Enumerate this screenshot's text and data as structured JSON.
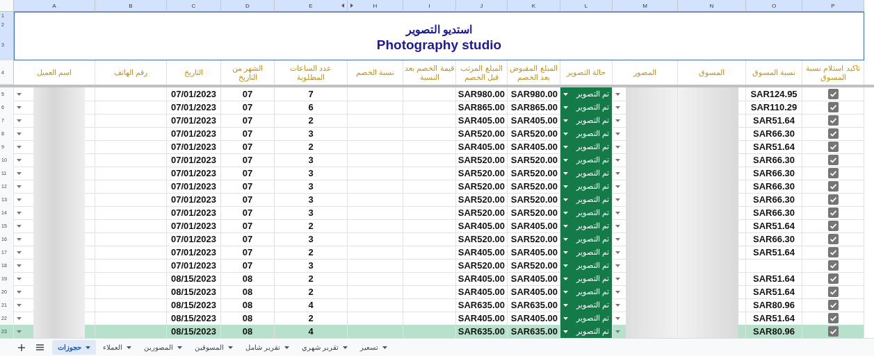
{
  "columns": [
    {
      "label": "P"
    },
    {
      "label": "O"
    },
    {
      "label": "N"
    },
    {
      "label": "M"
    },
    {
      "label": "L"
    },
    {
      "label": "K"
    },
    {
      "label": "J"
    },
    {
      "label": "I"
    },
    {
      "label": "H",
      "hidden_before": true
    },
    {
      "label": "E",
      "hidden_after": true
    },
    {
      "label": "D"
    },
    {
      "label": "C"
    },
    {
      "label": "B"
    },
    {
      "label": "A"
    }
  ],
  "title": {
    "row_numbers": [
      "1",
      "2",
      "3"
    ],
    "arabic": "استديو التصوير",
    "english": "Photography studio"
  },
  "header_row": {
    "number": "4",
    "cells": [
      "تاكيد استلام نسبة المسوق",
      "نسبة المسوق",
      "المسوق",
      "المصور",
      "حالة التصوير",
      "المبلغ المقبوض بعد الخصم",
      "المبلغ المرتب قبل الخصم",
      "قيمة الخصم بعد النسبة",
      "نسبة الخصم",
      "عدد الساعات المطلوبة",
      "الشهر من التاريخ",
      "التاريخ",
      "رقم الهاتف",
      "اسم العميل"
    ]
  },
  "rows": [
    {
      "number": "5",
      "date": "07/01/2023",
      "month": "07",
      "hours": "7",
      "before": "SAR980.00",
      "after": "SAR980.00",
      "status": "تم التصوير",
      "marketer_share": "SAR124.95",
      "checked": true,
      "selected": false
    },
    {
      "number": "6",
      "date": "07/01/2023",
      "month": "07",
      "hours": "6",
      "before": "SAR865.00",
      "after": "SAR865.00",
      "status": "تم التصوير",
      "marketer_share": "SAR110.29",
      "checked": true,
      "selected": false
    },
    {
      "number": "7",
      "date": "07/01/2023",
      "month": "07",
      "hours": "2",
      "before": "SAR405.00",
      "after": "SAR405.00",
      "status": "تم التصوير",
      "marketer_share": "SAR51.64",
      "checked": true,
      "selected": false
    },
    {
      "number": "8",
      "date": "07/01/2023",
      "month": "07",
      "hours": "3",
      "before": "SAR520.00",
      "after": "SAR520.00",
      "status": "تم التصوير",
      "marketer_share": "SAR66.30",
      "checked": true,
      "selected": false
    },
    {
      "number": "9",
      "date": "07/01/2023",
      "month": "07",
      "hours": "2",
      "before": "SAR405.00",
      "after": "SAR405.00",
      "status": "تم التصوير",
      "marketer_share": "SAR51.64",
      "checked": true,
      "selected": false
    },
    {
      "number": "10",
      "date": "07/01/2023",
      "month": "07",
      "hours": "3",
      "before": "SAR520.00",
      "after": "SAR520.00",
      "status": "تم التصوير",
      "marketer_share": "SAR66.30",
      "checked": true,
      "selected": false
    },
    {
      "number": "11",
      "date": "07/01/2023",
      "month": "07",
      "hours": "3",
      "before": "SAR520.00",
      "after": "SAR520.00",
      "status": "تم التصوير",
      "marketer_share": "SAR66.30",
      "checked": true,
      "selected": false
    },
    {
      "number": "12",
      "date": "07/01/2023",
      "month": "07",
      "hours": "3",
      "before": "SAR520.00",
      "after": "SAR520.00",
      "status": "تم التصوير",
      "marketer_share": "SAR66.30",
      "checked": true,
      "selected": false
    },
    {
      "number": "13",
      "date": "07/01/2023",
      "month": "07",
      "hours": "3",
      "before": "SAR520.00",
      "after": "SAR520.00",
      "status": "تم التصوير",
      "marketer_share": "SAR66.30",
      "checked": true,
      "selected": false
    },
    {
      "number": "14",
      "date": "07/01/2023",
      "month": "07",
      "hours": "3",
      "before": "SAR520.00",
      "after": "SAR520.00",
      "status": "تم التصوير",
      "marketer_share": "SAR66.30",
      "checked": true,
      "selected": false
    },
    {
      "number": "15",
      "date": "07/01/2023",
      "month": "07",
      "hours": "2",
      "before": "SAR405.00",
      "after": "SAR405.00",
      "status": "تم التصوير",
      "marketer_share": "SAR51.64",
      "checked": true,
      "selected": false
    },
    {
      "number": "16",
      "date": "07/01/2023",
      "month": "07",
      "hours": "3",
      "before": "SAR520.00",
      "after": "SAR520.00",
      "status": "تم التصوير",
      "marketer_share": "SAR66.30",
      "checked": true,
      "selected": false
    },
    {
      "number": "17",
      "date": "07/01/2023",
      "month": "07",
      "hours": "2",
      "before": "SAR405.00",
      "after": "SAR405.00",
      "status": "تم التصوير",
      "marketer_share": "SAR51.64",
      "checked": true,
      "selected": false
    },
    {
      "number": "18",
      "date": "07/01/2023",
      "month": "07",
      "hours": "3",
      "before": "SAR520.00",
      "after": "SAR520.00",
      "status": "تم التصوير",
      "checked": true,
      "selected": false
    },
    {
      "number": "19",
      "date": "08/15/2023",
      "month": "08",
      "hours": "2",
      "before": "SAR405.00",
      "after": "SAR405.00",
      "status": "تم التصوير",
      "marketer_share": "SAR51.64",
      "checked": true,
      "selected": false
    },
    {
      "number": "20",
      "date": "08/15/2023",
      "month": "08",
      "hours": "2",
      "before": "SAR405.00",
      "after": "SAR405.00",
      "status": "تم التصوير",
      "marketer_share": "SAR51.64",
      "checked": true,
      "selected": false
    },
    {
      "number": "21",
      "date": "08/15/2023",
      "month": "08",
      "hours": "4",
      "before": "SAR635.00",
      "after": "SAR635.00",
      "status": "تم التصوير",
      "marketer_share": "SAR80.96",
      "checked": true,
      "selected": false
    },
    {
      "number": "22",
      "date": "08/15/2023",
      "month": "08",
      "hours": "2",
      "before": "SAR405.00",
      "after": "SAR405.00",
      "status": "تم التصوير",
      "marketer_share": "SAR51.64",
      "checked": true,
      "selected": false
    },
    {
      "number": "23",
      "date": "08/15/2023",
      "month": "08",
      "hours": "4",
      "before": "SAR635.00",
      "after": "SAR635.00",
      "status": "تم التصوير",
      "marketer_share": "SAR80.96",
      "checked": true,
      "selected": true
    }
  ],
  "sheet_tabs": [
    {
      "label": "تسعير",
      "selected": false
    },
    {
      "label": "تقرير شهري",
      "selected": false
    },
    {
      "label": "تقرير شامل",
      "selected": false
    },
    {
      "label": "المسوقين",
      "selected": false
    },
    {
      "label": "المصورين",
      "selected": false
    },
    {
      "label": "العملاء",
      "selected": false
    },
    {
      "label": "حجوزات",
      "selected": true
    }
  ]
}
